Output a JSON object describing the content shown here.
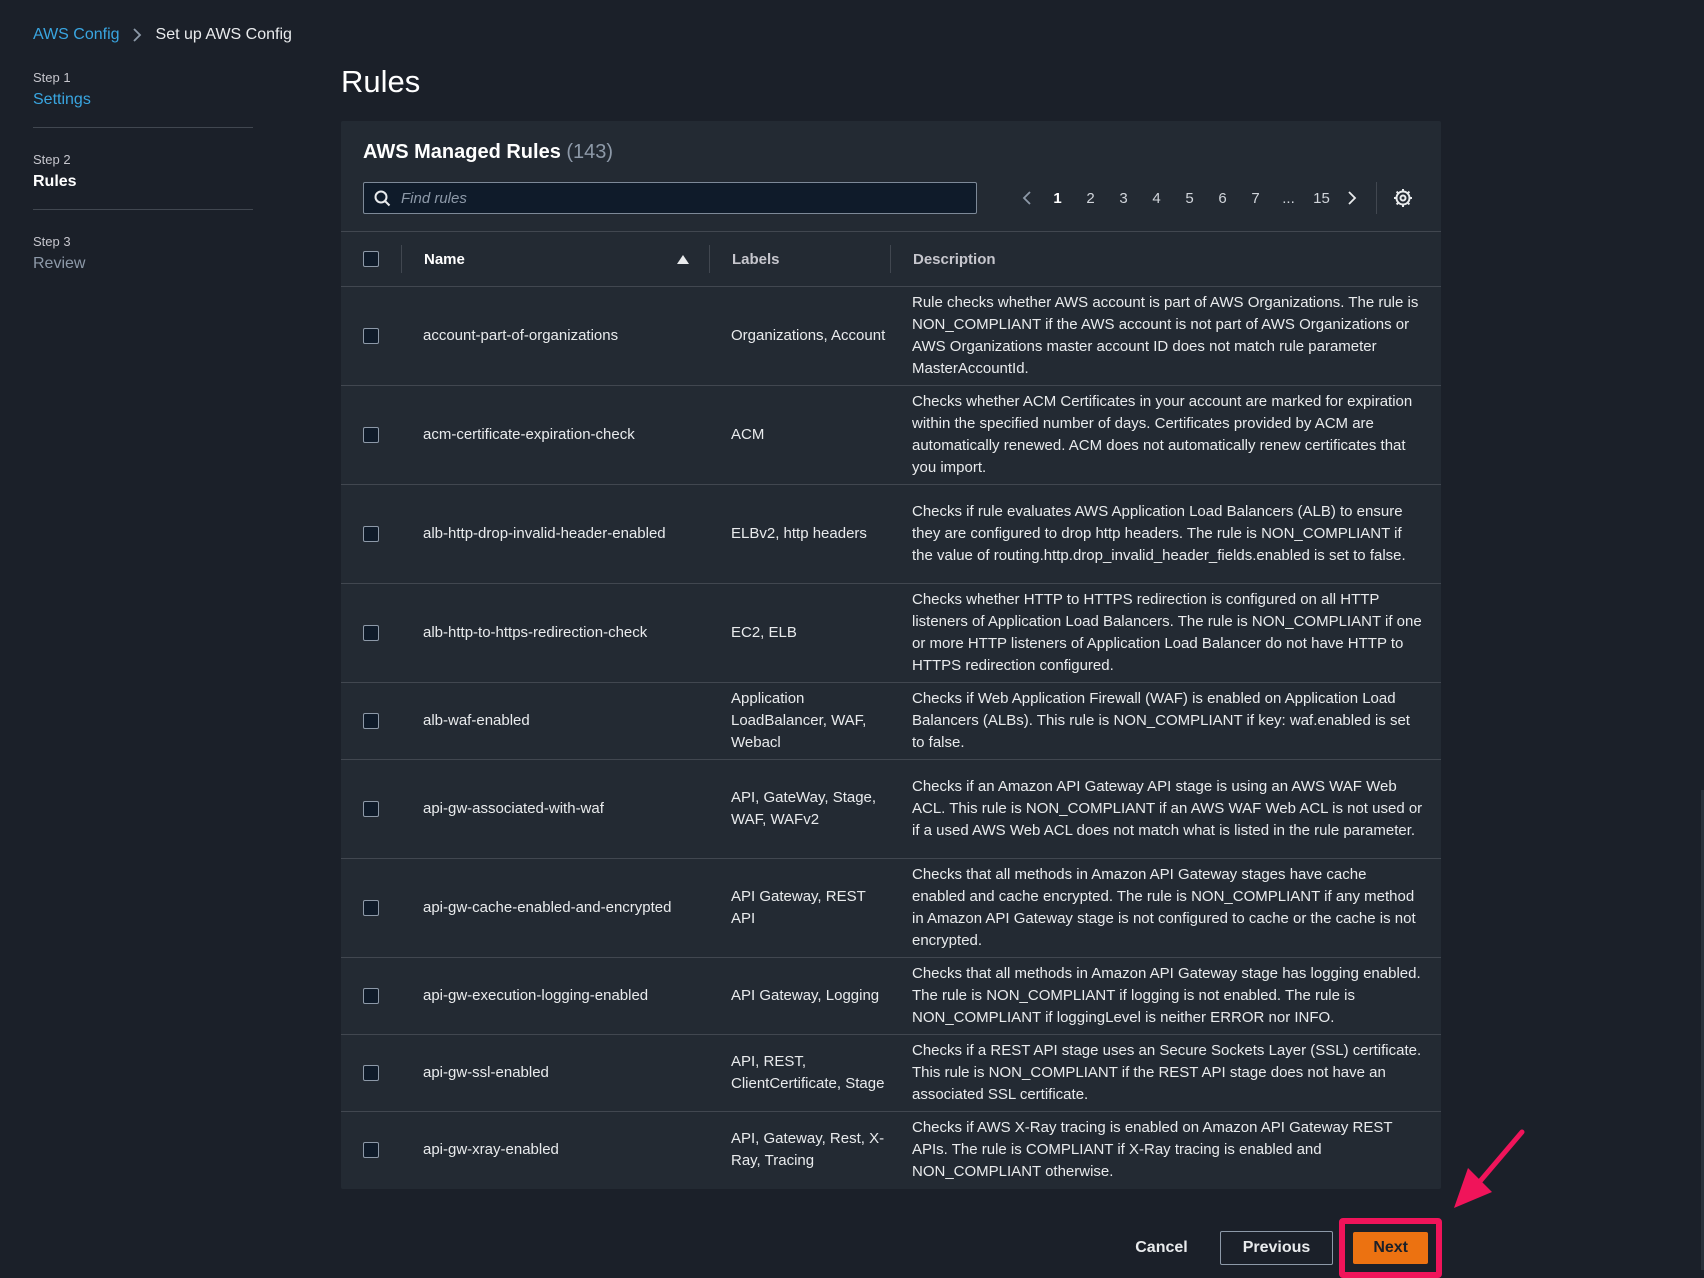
{
  "breadcrumb": {
    "parent": "AWS Config",
    "current": "Set up AWS Config"
  },
  "steps": [
    {
      "number": "Step 1",
      "label": "Settings",
      "state": "link"
    },
    {
      "number": "Step 2",
      "label": "Rules",
      "state": "active"
    },
    {
      "number": "Step 3",
      "label": "Review",
      "state": "disabled"
    }
  ],
  "page_title": "Rules",
  "rules_panel": {
    "title": "AWS Managed Rules",
    "count": "(143)",
    "search_placeholder": "Find rules",
    "pagination": {
      "pages": [
        "1",
        "2",
        "3",
        "4",
        "5",
        "6",
        "7"
      ],
      "ellipsis": "...",
      "last": "15",
      "current": "1"
    },
    "columns": {
      "name": "Name",
      "labels": "Labels",
      "description": "Description"
    },
    "rows": [
      {
        "name": "account-part-of-organizations",
        "labels": "Organizations, Account",
        "description": "Rule checks whether AWS account is part of AWS Organizations. The rule is NON_COMPLIANT if the AWS account is not part of AWS Organizations or AWS Organizations master account ID does not match rule parameter MasterAccountId."
      },
      {
        "name": "acm-certificate-expiration-check",
        "labels": "ACM",
        "description": "Checks whether ACM Certificates in your account are marked for expiration within the specified number of days. Certificates provided by ACM are automatically renewed. ACM does not automatically renew certificates that you import."
      },
      {
        "name": "alb-http-drop-invalid-header-enabled",
        "labels": "ELBv2, http headers",
        "description": "Checks if rule evaluates AWS Application Load Balancers (ALB) to ensure they are configured to drop http headers. The rule is NON_COMPLIANT if the value of routing.http.drop_invalid_header_fields.enabled is set to false."
      },
      {
        "name": "alb-http-to-https-redirection-check",
        "labels": "EC2, ELB",
        "description": "Checks whether HTTP to HTTPS redirection is configured on all HTTP listeners of Application Load Balancers. The rule is NON_COMPLIANT if one or more HTTP listeners of Application Load Balancer do not have HTTP to HTTPS redirection configured."
      },
      {
        "name": "alb-waf-enabled",
        "labels": "Application LoadBalancer, WAF, Webacl",
        "description": "Checks if Web Application Firewall (WAF) is enabled on Application Load Balancers (ALBs). This rule is NON_COMPLIANT if key: waf.enabled is set to false."
      },
      {
        "name": "api-gw-associated-with-waf",
        "labels": "API, GateWay, Stage, WAF, WAFv2",
        "description": "Checks if an Amazon API Gateway API stage is using an AWS WAF Web ACL. This rule is NON_COMPLIANT if an AWS WAF Web ACL is not used or if a used AWS Web ACL does not match what is listed in the rule parameter."
      },
      {
        "name": "api-gw-cache-enabled-and-encrypted",
        "labels": "API Gateway, REST API",
        "description": "Checks that all methods in Amazon API Gateway stages have cache enabled and cache encrypted. The rule is NON_COMPLIANT if any method in Amazon API Gateway stage is not configured to cache or the cache is not encrypted."
      },
      {
        "name": "api-gw-execution-logging-enabled",
        "labels": "API Gateway, Logging",
        "description": "Checks that all methods in Amazon API Gateway stage has logging enabled. The rule is NON_COMPLIANT if logging is not enabled. The rule is NON_COMPLIANT if loggingLevel is neither ERROR nor INFO."
      },
      {
        "name": "api-gw-ssl-enabled",
        "labels": "API, REST, ClientCertificate, Stage",
        "description": "Checks if a REST API stage uses an Secure Sockets Layer (SSL) certificate. This rule is NON_COMPLIANT if the REST API stage does not have an associated SSL certificate."
      },
      {
        "name": "api-gw-xray-enabled",
        "labels": "API, Gateway, Rest, X-Ray, Tracing",
        "description": "Checks if AWS X-Ray tracing is enabled on Amazon API Gateway REST APIs. The rule is COMPLIANT if X-Ray tracing is enabled and NON_COMPLIANT otherwise."
      }
    ]
  },
  "actions": {
    "cancel": "Cancel",
    "previous": "Previous",
    "next": "Next"
  },
  "colors": {
    "accent_link": "#39a5e0",
    "primary_button": "#ec7211",
    "highlight": "#f0145a",
    "background": "#1b2029",
    "panel": "#232a33"
  }
}
